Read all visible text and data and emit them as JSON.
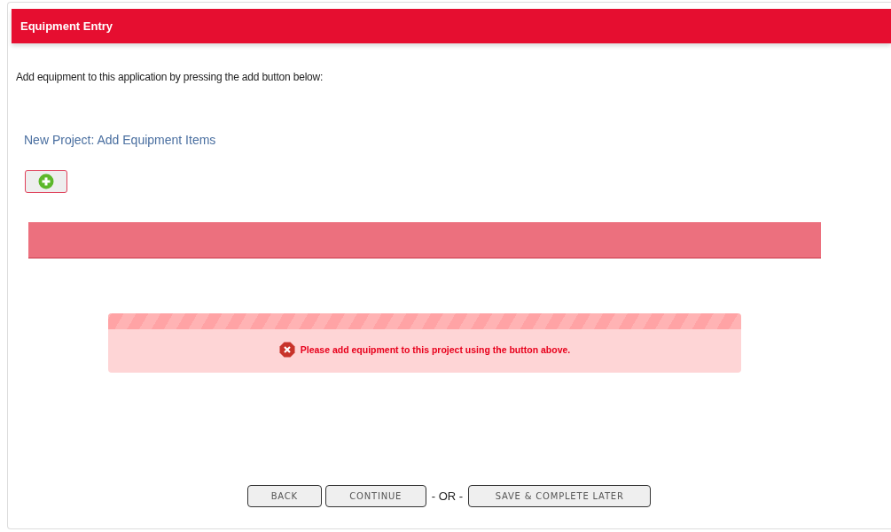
{
  "header": {
    "title": "Equipment Entry"
  },
  "intro": "Add equipment to this application by pressing the add button below:",
  "section_title": "New Project: Add Equipment Items",
  "alert": {
    "kind": "error",
    "message": "Please add equipment to this project using the button above."
  },
  "actions": [
    {
      "kind": "button",
      "label": "BACK"
    },
    {
      "kind": "button",
      "label": "CONTINUE"
    },
    {
      "kind": "separator",
      "label": "- OR -"
    },
    {
      "kind": "button",
      "label": "SAVE & COMPLETE LATER"
    }
  ]
}
